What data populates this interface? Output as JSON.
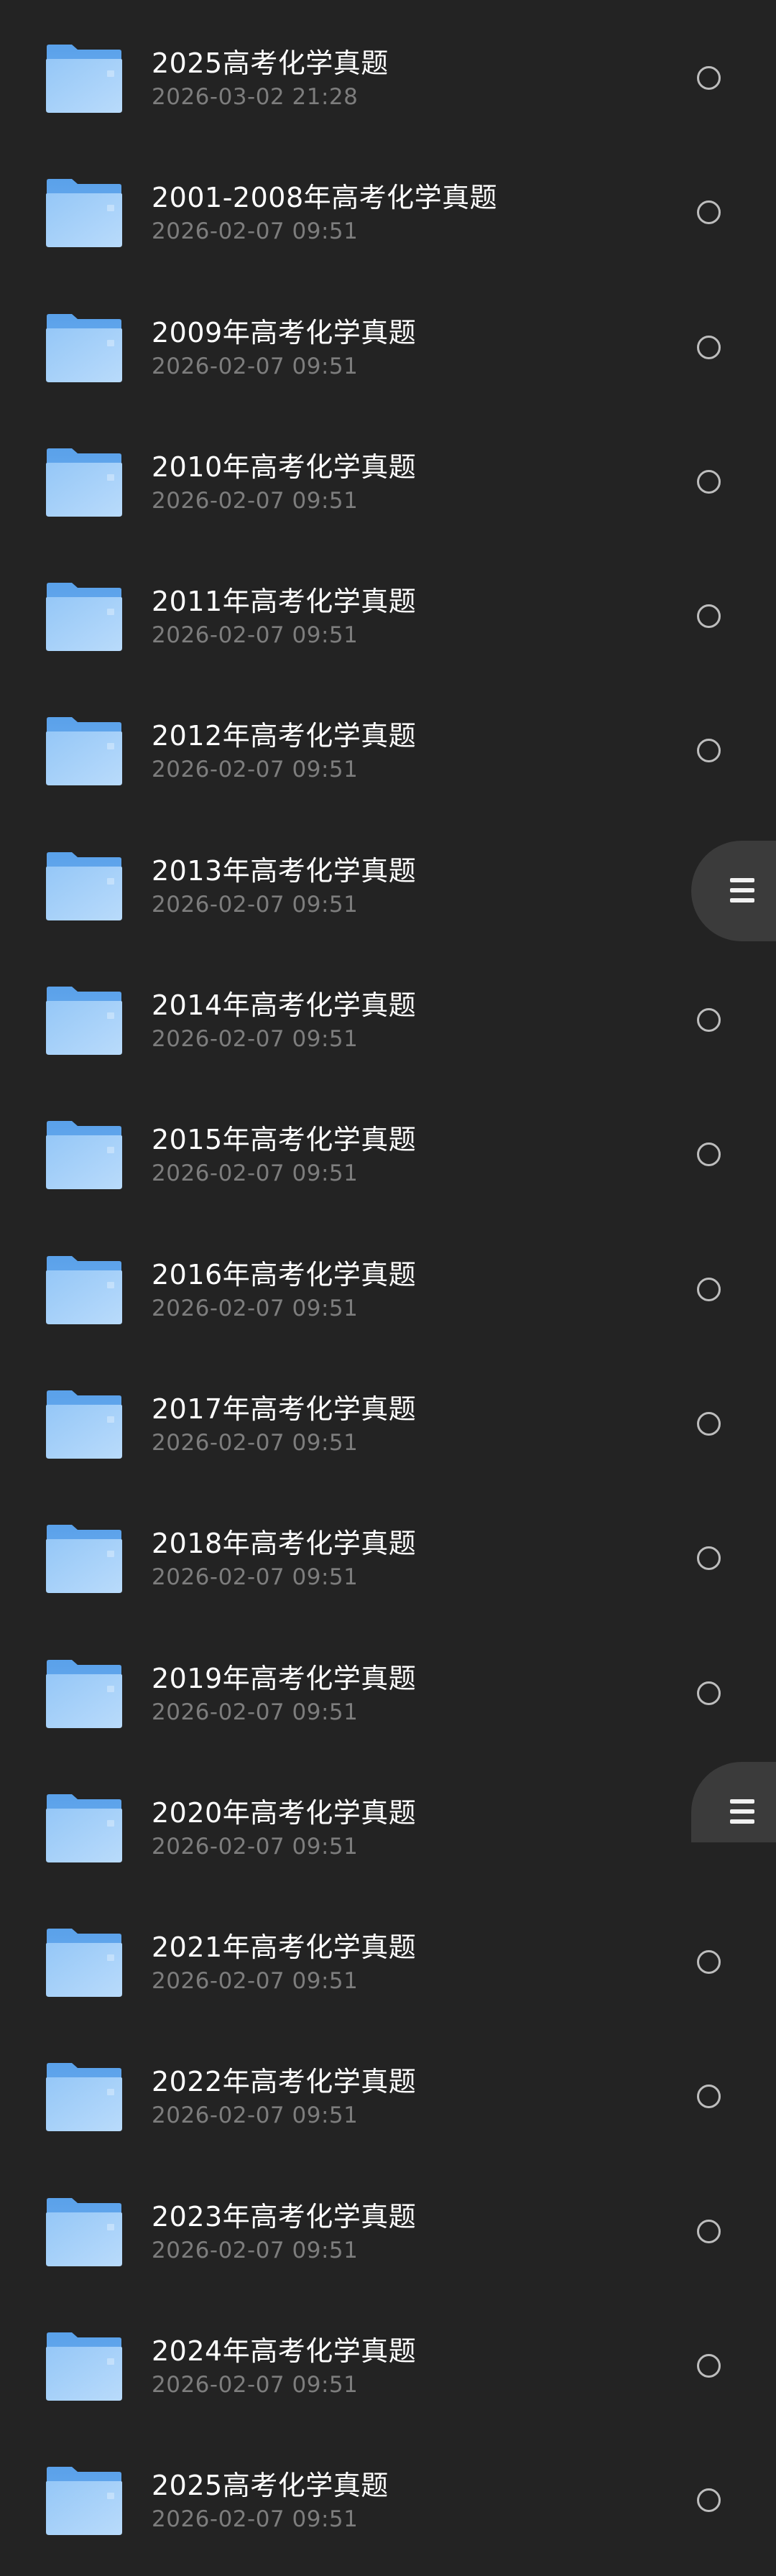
{
  "colors": {
    "background": "#232323",
    "title_text": "#ffffff",
    "date_text": "#7d7d7d",
    "folder_blue": "#8ec0f4",
    "fab_background": "#3b3b3b"
  },
  "icons": {
    "item": "folder-icon",
    "selector": "radio-circle-icon",
    "fab": "menu-lines-icon"
  },
  "files": [
    {
      "name": "2025高考化学真题",
      "date": "2026-03-02 21:28"
    },
    {
      "name": "2001-2008年高考化学真题",
      "date": "2026-02-07 09:51"
    },
    {
      "name": "2009年高考化学真题",
      "date": "2026-02-07 09:51"
    },
    {
      "name": "2010年高考化学真题",
      "date": "2026-02-07 09:51"
    },
    {
      "name": "2011年高考化学真题",
      "date": "2026-02-07 09:51"
    },
    {
      "name": "2012年高考化学真题",
      "date": "2026-02-07 09:51"
    },
    {
      "name": "2013年高考化学真题",
      "date": "2026-02-07 09:51"
    },
    {
      "name": "2014年高考化学真题",
      "date": "2026-02-07 09:51"
    },
    {
      "name": "2015年高考化学真题",
      "date": "2026-02-07 09:51"
    },
    {
      "name": "2016年高考化学真题",
      "date": "2026-02-07 09:51"
    },
    {
      "name": "2017年高考化学真题",
      "date": "2026-02-07 09:51"
    },
    {
      "name": "2018年高考化学真题",
      "date": "2026-02-07 09:51"
    },
    {
      "name": "2019年高考化学真题",
      "date": "2026-02-07 09:51"
    },
    {
      "name": "2020年高考化学真题",
      "date": "2026-02-07 09:51"
    },
    {
      "name": "2021年高考化学真题",
      "date": "2026-02-07 09:51"
    },
    {
      "name": "2022年高考化学真题",
      "date": "2026-02-07 09:51"
    },
    {
      "name": "2023年高考化学真题",
      "date": "2026-02-07 09:51"
    },
    {
      "name": "2024年高考化学真题",
      "date": "2026-02-07 09:51"
    },
    {
      "name": "2025高考化学真题",
      "date": "2026-02-07 09:51"
    }
  ]
}
